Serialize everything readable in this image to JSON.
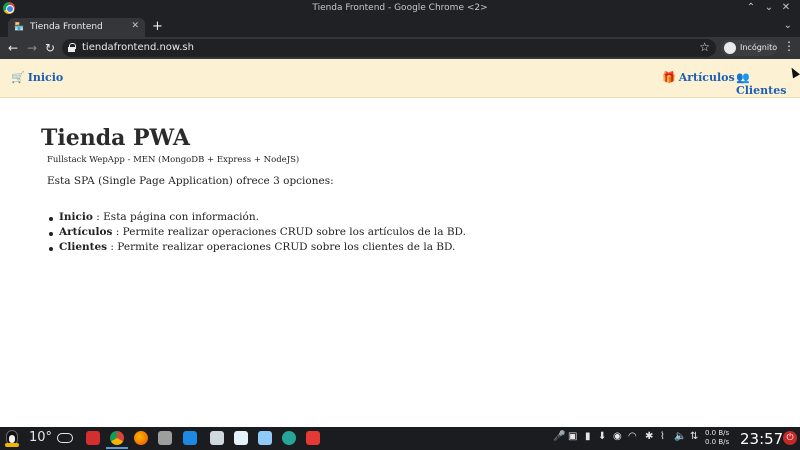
{
  "window": {
    "title": "Tienda Frontend - Google Chrome <2>"
  },
  "tabs": [
    {
      "label": "Tienda Frontend",
      "favicon": "store-icon"
    }
  ],
  "toolbar": {
    "url": "tiendafrontend.now.sh",
    "profile_label": "Incógnito"
  },
  "navbar": {
    "home_label": "Inicio",
    "articles_label": "Artículos",
    "clients_label": "Clientes"
  },
  "content": {
    "title": "Tienda PWA",
    "subtitle": "Fullstack WepApp - MEN (MongoDB + Express + NodeJS)",
    "lead": "Esta SPA (Single Page Application) ofrece 3 opciones:",
    "options": [
      {
        "term": "Inicio",
        "desc": " : Esta página con información."
      },
      {
        "term": "Artículos",
        "desc": " : Permite realizar operaciones CRUD sobre los artículos de la BD."
      },
      {
        "term": "Clientes",
        "desc": " : Permite realizar operaciones CRUD sobre los clientes de la BD."
      }
    ]
  },
  "taskbar": {
    "temperature": "10°",
    "net_up": "0.0 B/s",
    "net_down": "0.0 B/s",
    "clock": "23:57"
  },
  "colors": {
    "navbar_bg": "#fdf1d3",
    "link": "#1a5fb4",
    "titlebar": "#202124"
  }
}
